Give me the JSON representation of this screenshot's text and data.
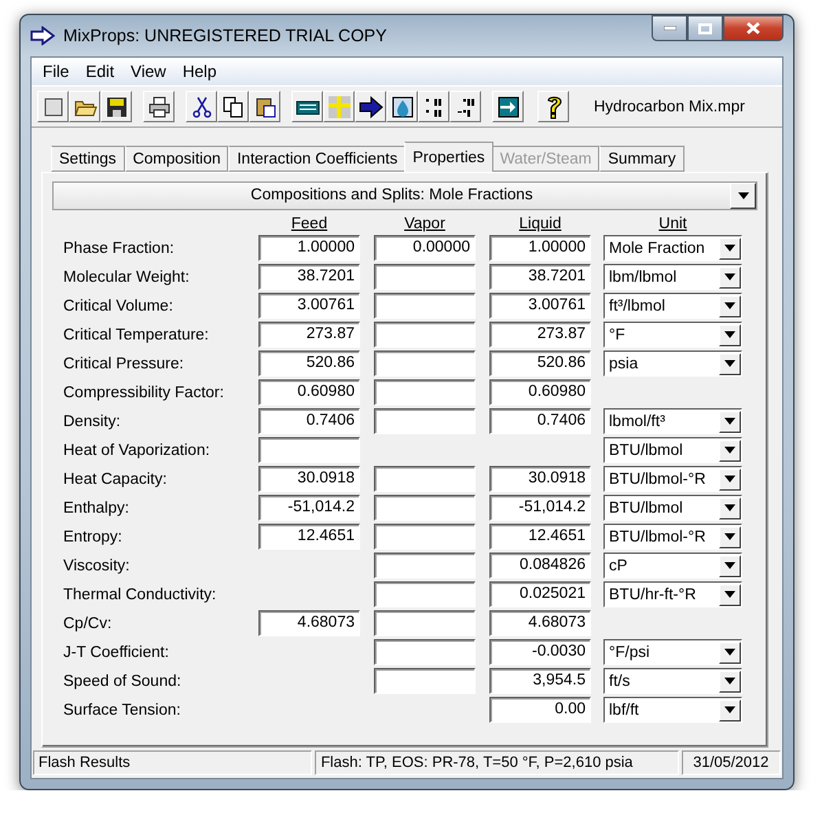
{
  "window": {
    "title": "MixProps:  UNREGISTERED TRIAL COPY"
  },
  "menu": [
    "File",
    "Edit",
    "View",
    "Help"
  ],
  "toolbar": {
    "file_name": "Hydrocarbon Mix.mpr"
  },
  "tabs": [
    {
      "label": "Settings",
      "selected": false,
      "disabled": false
    },
    {
      "label": "Composition",
      "selected": false,
      "disabled": false
    },
    {
      "label": "Interaction Coefficients",
      "selected": false,
      "disabled": false
    },
    {
      "label": "Properties",
      "selected": true,
      "disabled": false
    },
    {
      "label": "Water/Steam",
      "selected": false,
      "disabled": true
    },
    {
      "label": "Summary",
      "selected": false,
      "disabled": false
    }
  ],
  "basis_dropdown": {
    "value": "Compositions and Splits:  Mole Fractions"
  },
  "columns": [
    "Feed",
    "Vapor",
    "Liquid",
    "Unit"
  ],
  "rows": [
    {
      "label": "Phase Fraction:",
      "feed": {
        "value": "1.00000"
      },
      "vapor": {
        "value": "0.00000"
      },
      "liquid": {
        "value": "1.00000"
      },
      "unit": "Mole Fraction"
    },
    {
      "label": "Molecular Weight:",
      "feed": {
        "value": "38.7201"
      },
      "vapor": {
        "kind": "empty"
      },
      "liquid": {
        "value": "38.7201"
      },
      "unit": "lbm/lbmol"
    },
    {
      "label": "Critical Volume:",
      "feed": {
        "value": "3.00761"
      },
      "vapor": {
        "kind": "empty"
      },
      "liquid": {
        "value": "3.00761"
      },
      "unit": "ft³/lbmol"
    },
    {
      "label": "Critical Temperature:",
      "feed": {
        "value": "273.87"
      },
      "vapor": {
        "kind": "empty"
      },
      "liquid": {
        "value": "273.87"
      },
      "unit": "°F"
    },
    {
      "label": "Critical Pressure:",
      "feed": {
        "value": "520.86"
      },
      "vapor": {
        "kind": "empty"
      },
      "liquid": {
        "value": "520.86"
      },
      "unit": "psia"
    },
    {
      "label": "Compressibility Factor:",
      "feed": {
        "value": "0.60980"
      },
      "vapor": {
        "kind": "empty"
      },
      "liquid": {
        "value": "0.60980"
      }
    },
    {
      "label": "Density:",
      "feed": {
        "value": "0.7406"
      },
      "vapor": {
        "kind": "empty"
      },
      "liquid": {
        "value": "0.7406"
      },
      "unit": "lbmol/ft³"
    },
    {
      "label": "Heat of Vaporization:",
      "feed": {
        "kind": "empty"
      },
      "unit": "BTU/lbmol"
    },
    {
      "label": "Heat Capacity:",
      "feed": {
        "value": "30.0918"
      },
      "vapor": {
        "kind": "empty"
      },
      "liquid": {
        "value": "30.0918"
      },
      "unit": "BTU/lbmol-°R"
    },
    {
      "label": "Enthalpy:",
      "feed": {
        "value": "-51,014.2"
      },
      "vapor": {
        "kind": "empty"
      },
      "liquid": {
        "value": "-51,014.2"
      },
      "unit": "BTU/lbmol"
    },
    {
      "label": "Entropy:",
      "feed": {
        "value": "12.4651"
      },
      "vapor": {
        "kind": "empty"
      },
      "liquid": {
        "value": "12.4651"
      },
      "unit": "BTU/lbmol-°R"
    },
    {
      "label": "Viscosity:",
      "vapor": {
        "kind": "empty"
      },
      "liquid": {
        "value": "0.084826"
      },
      "unit": "cP"
    },
    {
      "label": "Thermal Conductivity:",
      "vapor": {
        "kind": "empty"
      },
      "liquid": {
        "value": "0.025021"
      },
      "unit": "BTU/hr-ft-°R"
    },
    {
      "label": "Cp/Cv:",
      "feed": {
        "value": "4.68073"
      },
      "vapor": {
        "kind": "empty"
      },
      "liquid": {
        "value": "4.68073"
      }
    },
    {
      "label": "J-T Coefficient:",
      "vapor": {
        "kind": "empty"
      },
      "liquid": {
        "value": "-0.0030"
      },
      "unit": "°F/psi"
    },
    {
      "label": "Speed of Sound:",
      "vapor": {
        "kind": "empty"
      },
      "liquid": {
        "value": "3,954.5"
      },
      "unit": "ft/s"
    },
    {
      "label": "Surface Tension:",
      "liquid": {
        "value": "0.00"
      },
      "unit": "lbf/ft"
    }
  ],
  "status_bar": [
    "Flash Results",
    "Flash: TP, EOS: PR-78, T=50 °F, P=2,610 psia",
    "31/05/2012"
  ]
}
